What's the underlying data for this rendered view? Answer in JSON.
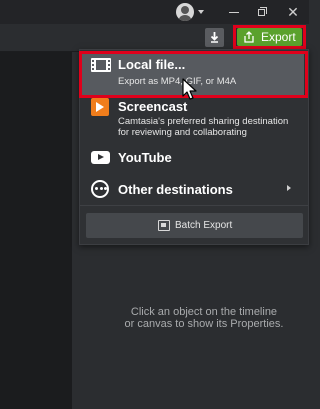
{
  "titlebar": {
    "icons": [
      "avatar-icon",
      "chevron-down-icon",
      "minimize-icon",
      "restore-icon",
      "close-icon"
    ],
    "close_glyph": "✕"
  },
  "toolbar": {
    "download_icon": "download-icon",
    "export_label": "Export",
    "export_icon": "share-export-icon",
    "colors": {
      "export_bg": "#5aa12c",
      "highlight": "#e0001b"
    }
  },
  "menu": {
    "items": [
      {
        "title": "Local file...",
        "subtitle": "Export as MP4, GIF, or M4A",
        "icon": "film-icon",
        "highlighted": true
      },
      {
        "title": "Screencast",
        "subtitle_line1": "Camtasia's preferred sharing destination",
        "subtitle_line2": "for reviewing and collaborating",
        "icon": "screencast-icon"
      },
      {
        "title": "YouTube",
        "icon": "youtube-icon"
      },
      {
        "title": "Other destinations",
        "icon": "more-icon",
        "has_submenu": true
      }
    ],
    "batch_export_label": "Batch Export"
  },
  "properties": {
    "hint_line1": "Click an object on the timeline",
    "hint_line2": "or canvas to show its Properties."
  }
}
